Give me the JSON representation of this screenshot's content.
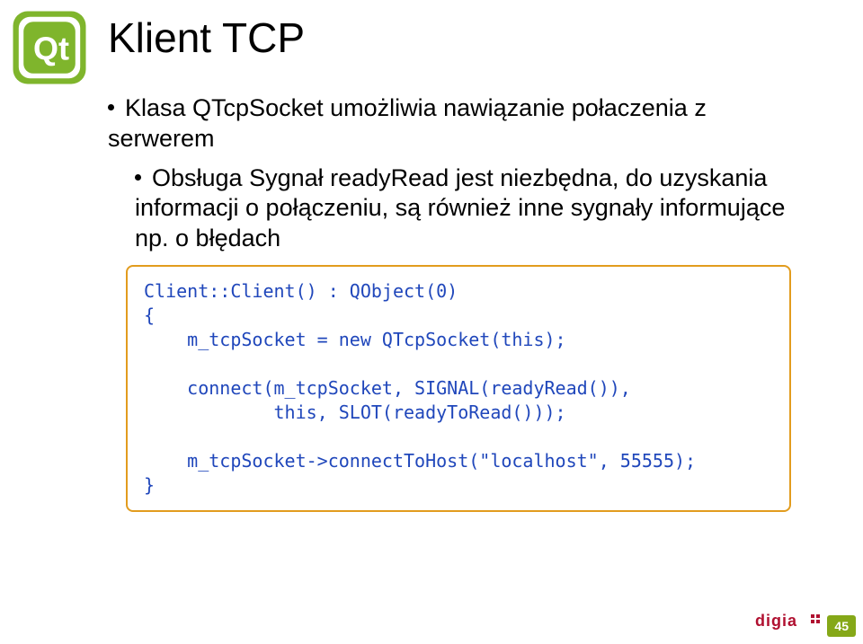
{
  "slide": {
    "title": "Klient TCP",
    "bullets": {
      "b1": "Klasa QTcpSocket umożliwia nawiązanie połaczenia z serwerem",
      "b2": "Obsługa Sygnał readyRead jest niezbędna, do uzyskania informacji o połączeniu, są również inne sygnały informujące np. o błędach"
    },
    "code": "Client::Client() : QObject(0)\n{\n    m_tcpSocket = new QTcpSocket(this);\n\n    connect(m_tcpSocket, SIGNAL(readyRead()),\n            this, SLOT(readyToRead()));\n\n    m_tcpSocket->connectToHost(\"localhost\", 55555);\n}"
  },
  "footer": {
    "brand": "digia",
    "page": "45"
  },
  "logo": {
    "name": "Qt"
  }
}
